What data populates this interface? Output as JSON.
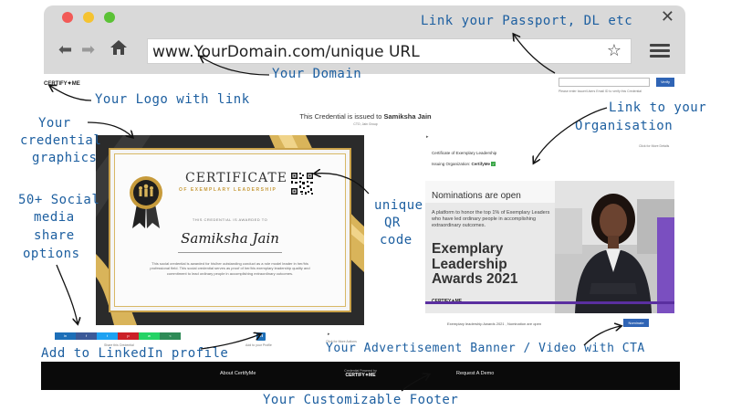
{
  "browser": {
    "url": "www.YourDomain.com/unique URL"
  },
  "annotations": {
    "passport": "Link your Passport, DL etc",
    "domain": "Your Domain",
    "logo": "Your Logo with link",
    "graphics_1": "Your",
    "graphics_2": "credential",
    "graphics_3": "graphics",
    "organisation_1": "Link to your",
    "organisation_2": "Organisation",
    "social_1": "50+ Social",
    "social_2": "media",
    "social_3": "share",
    "social_4": "options",
    "qr_1": "unique",
    "qr_2": "QR",
    "qr_3": "code",
    "linkedin": "Add to LinkedIn  profile",
    "banner": "Your Advertisement Banner / Video with CTA",
    "footer": "Your Customizable Footer"
  },
  "header": {
    "logo_text": "CERTIFY✦ME",
    "verify_button": "Verify",
    "verify_hint": "Please enter Issuer/Users Email ID to verify this Credential"
  },
  "credential": {
    "issued_prefix": "This Credential is issued to",
    "recipient": "Samiksha Jain",
    "issued_sub": "CTO, Jain Group"
  },
  "certificate": {
    "title": "CERTIFICATE",
    "subtitle": "OF EXEMPLARY LEADERSHIP",
    "awarded": "THIS CREDENTIAL IS AWARDED TO",
    "name": "Samiksha Jain",
    "body": "This social credential is awarded for his/her outstanding conduct as a role model leader in her/his professional field. This social credential serves as proof of her/his exemplary leadership quality and commitment to lead ordinary people in accomplishing extraordinary outcomes."
  },
  "share": {
    "buttons": [
      {
        "label": "in",
        "color": "#1d6fb8"
      },
      {
        "label": "f",
        "color": "#3b5998"
      },
      {
        "label": "t",
        "color": "#1da1f2"
      },
      {
        "label": "p",
        "color": "#cb2027"
      },
      {
        "label": "w",
        "color": "#25d366"
      },
      {
        "label": "<",
        "color": "#2e8b57"
      }
    ],
    "caption": "Share this Credential",
    "linkedin_badge": "in",
    "linkedin_caption": "Add to your Profile"
  },
  "organisation": {
    "more_details": "Click for More Details",
    "credential_title": "Certificate of Exemplary Leadership",
    "issuing_label": "Issuing Organization:",
    "issuing_name": "CertifyMe"
  },
  "banner": {
    "heading": "Nominations are open",
    "text": "A platform to honor the top 1% of Exemplary Leaders who have led ordinary people in accomplishing extraordinary outcomes.",
    "headline_1": "Exemplary",
    "headline_2": "Leadership",
    "headline_3": "Awards 2021",
    "logo": "CERTIFY✦ME",
    "caption": "Exemplary leadership Awards 2021 , Nomination are open",
    "cta": "Nominate"
  },
  "actions": {
    "more_actions": "Click for More Actions"
  },
  "footer": {
    "about": "About CertifyMe",
    "powered_by": "Credential Powered by",
    "powered_brand": "CERTIFY✦ME",
    "request_demo": "Request A Demo"
  }
}
